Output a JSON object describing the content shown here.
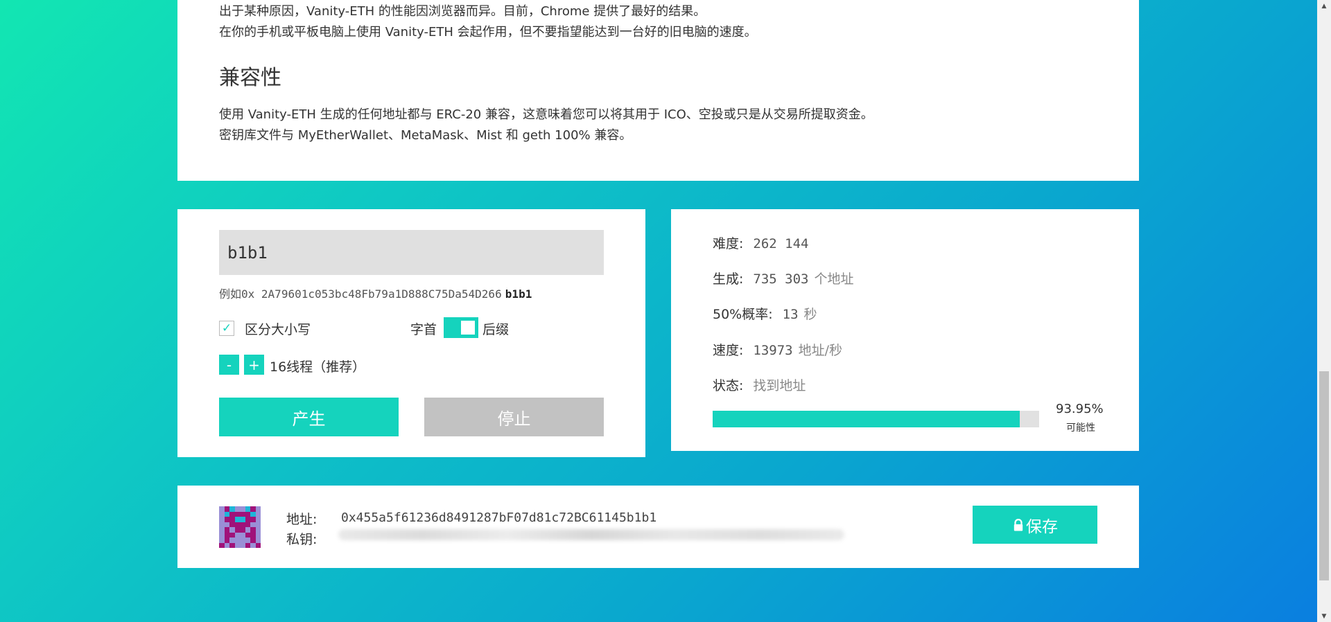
{
  "about": {
    "line1": "出于某种原因，Vanity-ETH 的性能因浏览器而异。目前，Chrome 提供了最好的结果。",
    "line2": "在你的手机或平板电脑上使用 Vanity-ETH 会起作用，但不要指望能达到一台好的旧电脑的速度。",
    "compat_heading": "兼容性",
    "compat_line1": "使用 Vanity-ETH 生成的任何地址都与 ERC-20 兼容，这意味着您可以将其用于 ICO、空投或只是从交易所提取资金。",
    "compat_line2": "密钥库文件与 MyEtherWallet、MetaMask、Mist 和 geth 100% 兼容。"
  },
  "generator": {
    "input_value": "b1b1",
    "example_prefix": "例如",
    "example_address": "0x 2A79601c053bc48Fb79a1D888C75Da54D266",
    "example_suffix": "b1b1",
    "case_sensitive_label": "区分大小写",
    "case_sensitive_checked": true,
    "prefix_label": "字首",
    "suffix_label": "后缀",
    "minus_label": "-",
    "plus_label": "+",
    "threads_label": "16线程（推荐）",
    "generate_label": "产生",
    "stop_label": "停止"
  },
  "stats": {
    "difficulty_label": "难度:",
    "difficulty_value": "262 144",
    "generated_label": "生成:",
    "generated_value": "735 303",
    "generated_unit": "个地址",
    "probability_label": "50%概率:",
    "probability_value": "13",
    "probability_unit": "秒",
    "speed_label": "速度:",
    "speed_value": "13973",
    "speed_unit": "地址/秒",
    "status_label": "状态:",
    "status_value": "找到地址",
    "progress_percent": 93.95,
    "progress_text": "93.95%",
    "progress_caption": "可能性"
  },
  "result": {
    "address_label": "地址:",
    "address_value": "0x455a5f61236d8491287bF07d81c72BC61145b1b1",
    "private_key_label": "私钥:",
    "save_label": "保存"
  },
  "colors": {
    "accent": "#15d3bd",
    "identicon_bg": "#9a8fd6",
    "identicon_fg": "#a0127a",
    "identicon_spot": "#1fb5d8"
  },
  "icons": {
    "save": "lock-icon",
    "checkbox": "check-icon"
  }
}
